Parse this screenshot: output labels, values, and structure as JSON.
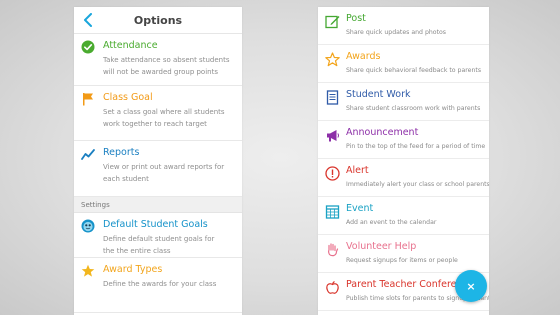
{
  "options_screen": {
    "title": "Options",
    "back_icon": "chevron-left-icon",
    "rows": [
      {
        "icon": "checkmark-circle-icon",
        "title": "Attendance",
        "title_color": "#4aab2f",
        "desc1": "Take attendance so absent students",
        "desc2": "will not be awarded group points"
      },
      {
        "icon": "flag-icon",
        "title": "Class Goal",
        "title_color": "#f29a16",
        "desc1": "Set a class goal where all students",
        "desc2": "work together to reach target"
      },
      {
        "icon": "trend-line-icon",
        "title": "Reports",
        "title_color": "#1a7fc1",
        "desc1": "View or print out award reports for",
        "desc2": "each student"
      }
    ],
    "section_label": "Settings",
    "settings_rows": [
      {
        "icon": "monster-face-icon",
        "title": "Default Student Goals",
        "title_color": "#1592c9",
        "desc1": "Define default student goals for",
        "desc2": "the the entire class"
      },
      {
        "icon": "star-icon",
        "title": "Award Types",
        "title_color": "#f2a51d",
        "desc1": "Define the awards for your class",
        "desc2": ""
      }
    ]
  },
  "post_menu": {
    "items": [
      {
        "icon": "compose-icon",
        "title": "Post",
        "title_color": "#45a832",
        "desc": "Share quick updates and photos"
      },
      {
        "icon": "star-outline-icon",
        "title": "Awards",
        "title_color": "#f3a41a",
        "desc": "Share quick behavioral feedback to parents"
      },
      {
        "icon": "document-icon",
        "title": "Student Work",
        "title_color": "#2f5ba8",
        "desc": "Share student classroom work with parents"
      },
      {
        "icon": "megaphone-icon",
        "title": "Announcement",
        "title_color": "#8d2fa8",
        "desc": "Pin to the top of the feed for a period of time"
      },
      {
        "icon": "alert-icon",
        "title": "Alert",
        "title_color": "#d9342b",
        "desc": "Immediately alert your class or school parents"
      },
      {
        "icon": "calendar-icon",
        "title": "Event",
        "title_color": "#1aa2c4",
        "desc": "Add an event to the calendar"
      },
      {
        "icon": "raised-hand-icon",
        "title": "Volunteer Help",
        "title_color": "#e8718d",
        "desc": "Request signups for items or people"
      },
      {
        "icon": "apple-icon",
        "title": "Parent Teacher Conferences",
        "title_color": "#d9342b",
        "desc": "Publish time slots for parents to signup instantly"
      }
    ],
    "close_label": "×",
    "close_icon": "close-icon",
    "fab_color": "#1db5e6"
  }
}
